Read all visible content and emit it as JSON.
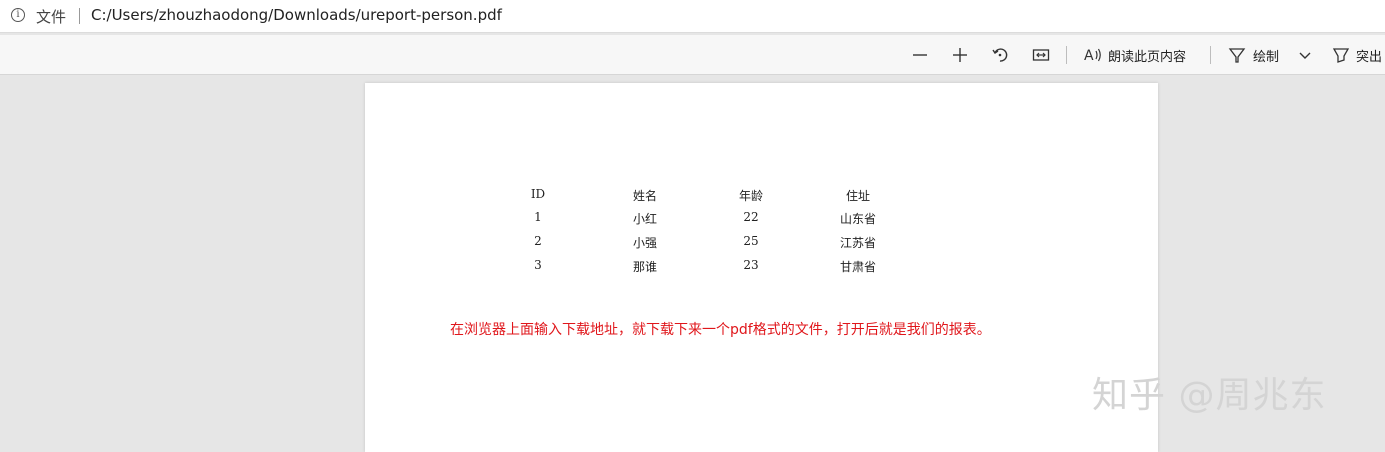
{
  "address_bar": {
    "label": "文件",
    "url": "C:/Users/zhouzhaodong/Downloads/ureport-person.pdf"
  },
  "toolbar": {
    "read_aloud": "朗读此页内容",
    "draw": "绘制",
    "highlight": "突出"
  },
  "table": {
    "headers": [
      "ID",
      "姓名",
      "年龄",
      "住址"
    ],
    "rows": [
      [
        "1",
        "小红",
        "22",
        "山东省"
      ],
      [
        "2",
        "小强",
        "25",
        "江苏省"
      ],
      [
        "3",
        "那谁",
        "23",
        "甘肃省"
      ]
    ]
  },
  "note": "在浏览器上面输入下载地址，就下载下来一个pdf格式的文件，打开后就是我们的报表。",
  "watermark": "知乎 @周兆东",
  "colors": {
    "note": "#e0161b",
    "background": "#e6e6e6"
  }
}
